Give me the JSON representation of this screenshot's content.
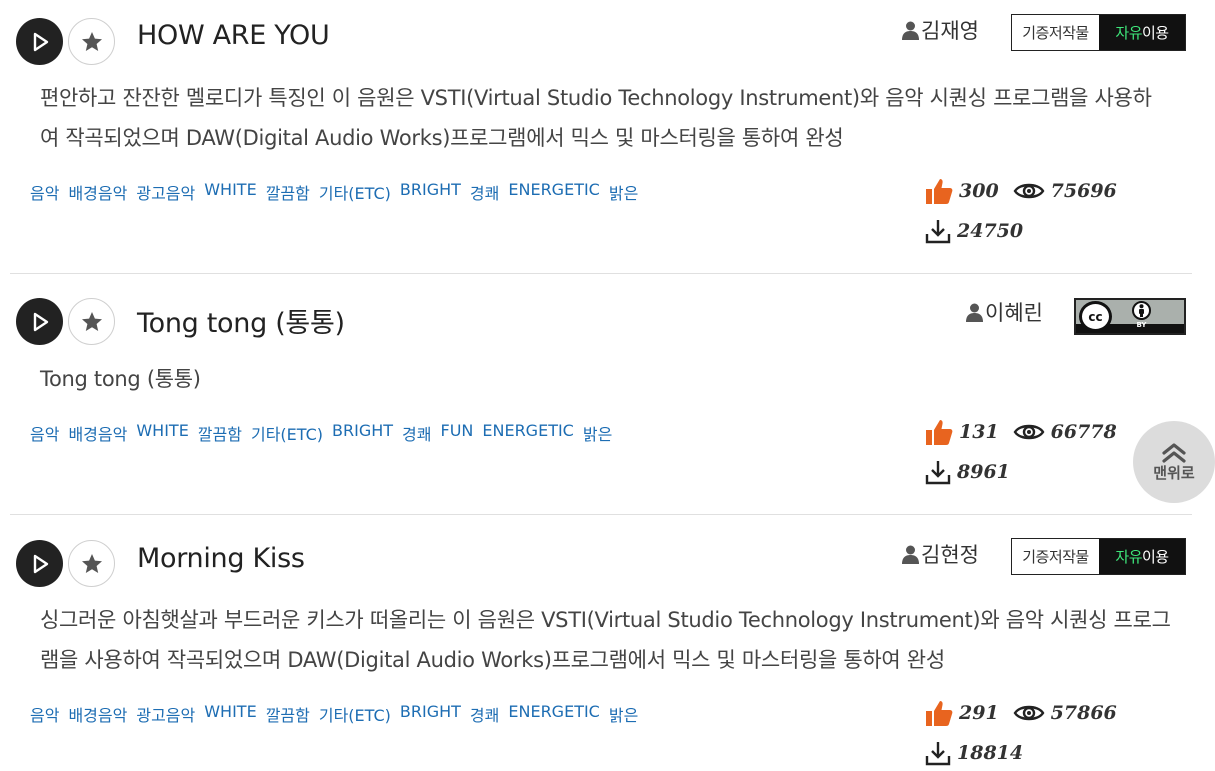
{
  "tracks": [
    {
      "title": "HOW ARE YOU",
      "author": "김재영",
      "license": {
        "type": "free",
        "left": "기증저작물",
        "right_accent": "자유",
        "right_rest": "이용"
      },
      "description": "편안하고 잔잔한 멜로디가 특징인 이 음원은 VSTI(Virtual Studio Technology Instrument)와 음악 시퀀싱 프로그램을 사용하여 작곡되었으며 DAW(Digital Audio Works)프로그램에서 믹스 및 마스터링을 통하여 완성",
      "tags": [
        "음악",
        "배경음악",
        "광고음악",
        "WHITE",
        "깔끔함",
        "기타(ETC)",
        "BRIGHT",
        "경쾌",
        "ENERGETIC",
        "밝은"
      ],
      "likes": "300",
      "views": "75696",
      "downloads": "24750"
    },
    {
      "title": "Tong tong (통통)",
      "author": "이혜린",
      "license": {
        "type": "cc-by",
        "cc": "cc",
        "by": "BY"
      },
      "description": "Tong tong (통통)",
      "tags": [
        "음악",
        "배경음악",
        "WHITE",
        "깔끔함",
        "기타(ETC)",
        "BRIGHT",
        "경쾌",
        "FUN",
        "ENERGETIC",
        "밝은"
      ],
      "likes": "131",
      "views": "66778",
      "downloads": "8961"
    },
    {
      "title": "Morning Kiss",
      "author": "김현정",
      "license": {
        "type": "free",
        "left": "기증저작물",
        "right_accent": "자유",
        "right_rest": "이용"
      },
      "description": "싱그러운 아침햇살과 부드러운 키스가 떠올리는 이 음원은 VSTI(Virtual Studio Technology Instrument)와 음악 시퀀싱 프로그램을 사용하여 작곡되었으며 DAW(Digital Audio Works)프로그램에서 믹스 및 마스터링을 통하여 완성",
      "tags": [
        "음악",
        "배경음악",
        "광고음악",
        "WHITE",
        "깔끔함",
        "기타(ETC)",
        "BRIGHT",
        "경쾌",
        "ENERGETIC",
        "밝은"
      ],
      "likes": "291",
      "views": "57866",
      "downloads": "18814"
    }
  ],
  "to_top": {
    "label": "맨위로",
    "icon": "double-chevron-up-icon"
  },
  "colors": {
    "tag": "#1d6db3",
    "like": "#e8641f",
    "license_accent": "#3ee67a"
  }
}
